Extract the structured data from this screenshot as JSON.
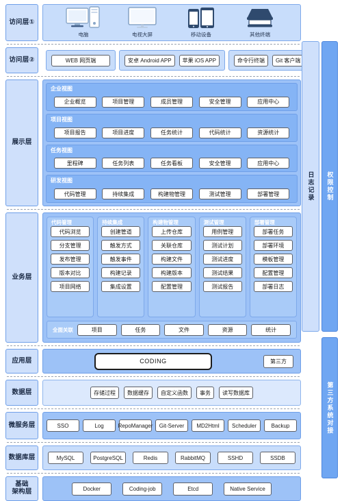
{
  "layers": {
    "access1": {
      "label": "访问层①",
      "devices": [
        {
          "name": "电脑",
          "icon": "desktop-computer-icon"
        },
        {
          "name": "电视大屏",
          "icon": "tv-screen-icon"
        },
        {
          "name": "移动设备",
          "icon": "mobile-devices-icon"
        },
        {
          "name": "其他终端",
          "icon": "other-terminal-icon"
        }
      ]
    },
    "access2": {
      "label": "访问层②",
      "groups": [
        {
          "items": [
            "WEB 网页端"
          ]
        },
        {
          "items": [
            "安卓 Android APP",
            "苹果 iOS APP"
          ]
        },
        {
          "items": [
            "命令行终端",
            "Git 客户端"
          ]
        }
      ]
    },
    "display": {
      "label": "展示层",
      "views": [
        {
          "title": "企业视图",
          "items": [
            "企业概览",
            "项目管理",
            "成员管理",
            "安全管理",
            "应用中心"
          ]
        },
        {
          "title": "项目视图",
          "items": [
            "项目报告",
            "项目进度",
            "任务统计",
            "代码统计",
            "资源统计"
          ]
        },
        {
          "title": "任务视图",
          "items": [
            "里程碑",
            "任务列表",
            "任务看板",
            "安全管理",
            "应用中心"
          ]
        },
        {
          "title": "研发视图",
          "items": [
            "代码管理",
            "持续集成",
            "构建物管理",
            "测试管理",
            "部署管理"
          ]
        }
      ]
    },
    "business": {
      "label": "业务层",
      "groups": [
        {
          "title": "代码管理",
          "items": [
            "代码浏览",
            "分支管理",
            "发布管理",
            "版本对比",
            "项目网络"
          ]
        },
        {
          "title": "持续集成",
          "items": [
            "创建管道",
            "触发方式",
            "触发事件",
            "构建记录",
            "集成设置"
          ]
        },
        {
          "title": "构建物管理",
          "items": [
            "上传仓库",
            "关联仓库",
            "构建文件",
            "构建版本",
            "配置管理"
          ]
        },
        {
          "title": "测试管理",
          "items": [
            "用例管理",
            "测试计划",
            "测试进度",
            "测试结果",
            "测试报告"
          ]
        },
        {
          "title": "部署管理",
          "items": [
            "部署任务",
            "部署环境",
            "模板管理",
            "配置管理",
            "部署日志"
          ]
        }
      ],
      "relation": {
        "title": "全面关联",
        "items": [
          "项目",
          "任务",
          "文件",
          "资源",
          "统计"
        ]
      }
    },
    "application": {
      "label": "应用层",
      "primary": "CODING",
      "secondary": "第三方"
    },
    "data": {
      "label": "数据层",
      "items": [
        "存储过程",
        "数据缓存",
        "自定义函数",
        "事务",
        "读写数据库"
      ]
    },
    "microservice": {
      "label": "微服务层",
      "items": [
        "SSO",
        "Log",
        "RepoManager",
        "Git-Server",
        "MD2Html",
        "Scheduler",
        "Backup"
      ]
    },
    "database": {
      "label": "数据库层",
      "items": [
        "MySQL",
        "PostgreSQL",
        "Redis",
        "RabbitMQ",
        "SSHD",
        "SSDB"
      ]
    },
    "infrastructure": {
      "label": "基础\n架构层",
      "label_line1": "基础",
      "label_line2": "架构层",
      "items": [
        "Docker",
        "Coding-job",
        "Etcd",
        "Native Service"
      ]
    }
  },
  "side_bars": {
    "log": "日志记录",
    "permission": "权限控制",
    "third_party": "第三方系统对接"
  },
  "colors": {
    "panel_mid": "#9dc2f7",
    "panel_light": "#c8ddfb",
    "panel_pale": "#dce9fd",
    "accent": "#6fa6f2",
    "border": "#6f9fe8",
    "view_row": "#85b4f5",
    "biz_group": "#a9cbf8"
  }
}
